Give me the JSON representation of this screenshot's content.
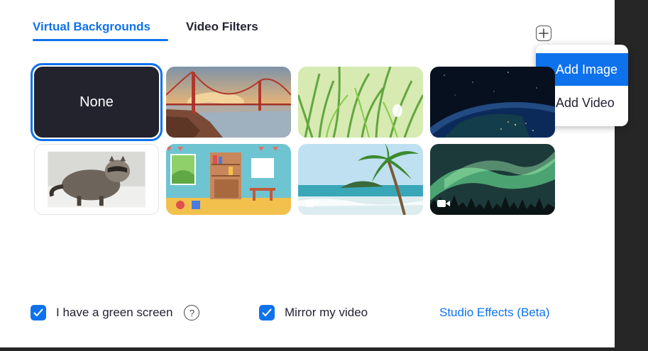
{
  "tabs": [
    {
      "label": "Virtual Backgrounds",
      "active": true
    },
    {
      "label": "Video Filters",
      "active": false
    }
  ],
  "add_menu": {
    "items": [
      {
        "label": "Add Image",
        "highlighted": true
      },
      {
        "label": "Add Video",
        "highlighted": false
      }
    ]
  },
  "backgrounds": [
    {
      "label": "None",
      "selected": true,
      "kind": "none"
    },
    {
      "kind": "golden-gate-bridge",
      "video": false
    },
    {
      "kind": "grass",
      "video": false
    },
    {
      "kind": "earth-from-space",
      "video": false
    },
    {
      "kind": "raccoon",
      "video": false
    },
    {
      "kind": "playroom",
      "video": false
    },
    {
      "kind": "beach-palm",
      "video": true
    },
    {
      "kind": "aurora",
      "video": true
    }
  ],
  "footer": {
    "green_screen_label": "I have a green screen",
    "green_screen_checked": true,
    "mirror_label": "Mirror my video",
    "mirror_checked": true,
    "studio_effects_label": "Studio Effects (Beta)"
  },
  "colors": {
    "accent": "#0e72ed",
    "text": "#232333",
    "dark_tile": "#23232e"
  }
}
